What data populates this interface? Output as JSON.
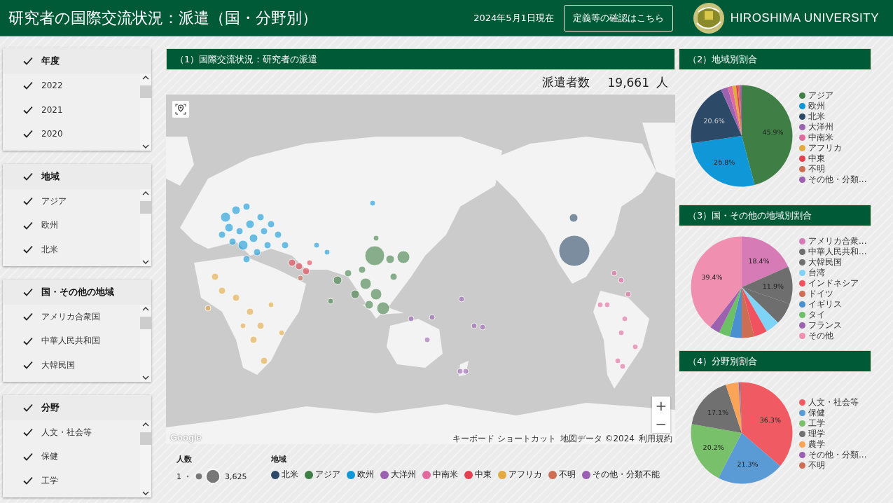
{
  "header": {
    "title": "研究者の国際交流状況：派遣（国・分野別）",
    "date": "2024年5月1日現在",
    "link_button": "定義等の確認はこちら",
    "logo_text": "HIROSHIMA UNIVERSITY"
  },
  "filters": [
    {
      "title": "年度",
      "checked": true,
      "items": [
        {
          "label": "2022",
          "checked": true
        },
        {
          "label": "2021",
          "checked": true
        },
        {
          "label": "2020",
          "checked": true
        }
      ]
    },
    {
      "title": "地域",
      "checked": true,
      "items": [
        {
          "label": "アジア",
          "checked": true
        },
        {
          "label": "欧州",
          "checked": true
        },
        {
          "label": "北米",
          "checked": true
        }
      ]
    },
    {
      "title": "国・その他の地域",
      "checked": true,
      "items": [
        {
          "label": "アメリカ合衆国",
          "checked": true
        },
        {
          "label": "中華人民共和国",
          "checked": true
        },
        {
          "label": "大韓民国",
          "checked": true
        }
      ]
    },
    {
      "title": "分野",
      "checked": true,
      "items": [
        {
          "label": "人文・社会等",
          "checked": true
        },
        {
          "label": "保健",
          "checked": true
        },
        {
          "label": "工学",
          "checked": true
        }
      ]
    }
  ],
  "map_panel": {
    "title": "（1）国際交流状況：研究者の派遣",
    "count_label": "派遣者数",
    "count": "19,661",
    "count_unit": "人",
    "zoom_in": "+",
    "zoom_out": "−",
    "google": "Google",
    "attribution": [
      "キーボード ショートカット",
      "地図データ ©2024",
      "利用規約"
    ],
    "size_legend": {
      "title": "人数",
      "min": "1",
      "max": "3,625"
    },
    "region_legend": {
      "title": "地域",
      "items": [
        {
          "label": "北米",
          "color": "#2c4a67"
        },
        {
          "label": "アジア",
          "color": "#3f7f45"
        },
        {
          "label": "欧州",
          "color": "#0f97d8"
        },
        {
          "label": "大洋州",
          "color": "#9b62b0"
        },
        {
          "label": "中南米",
          "color": "#e0699e"
        },
        {
          "label": "中東",
          "color": "#e5404f"
        },
        {
          "label": "アフリカ",
          "color": "#e2a93f"
        },
        {
          "label": "不明",
          "color": "#cd6d53"
        },
        {
          "label": "その他・分類不能",
          "color": "#9b5fb4"
        }
      ]
    }
  },
  "pies": [
    {
      "title": "（2）地域別割合",
      "chart_data": {
        "type": "pie",
        "categories": [
          "アジア",
          "欧州",
          "北米",
          "大洋州",
          "中南米",
          "アフリカ",
          "中東",
          "不明",
          "その他・分類..."
        ],
        "values": [
          45.9,
          26.8,
          20.6,
          2.2,
          1.5,
          1.2,
          0.6,
          0.6,
          0.6
        ],
        "colors": [
          "#3f7f45",
          "#0f97d8",
          "#2c4a67",
          "#9b62b0",
          "#e0699e",
          "#e2a93f",
          "#e5404f",
          "#cd6d53",
          "#9b5fb4"
        ],
        "value_labels": [
          "45.9%",
          "26.8%",
          "20.6%",
          null,
          null,
          null,
          null,
          null,
          null
        ]
      }
    },
    {
      "title": "（3）国・その他の地域別割合",
      "chart_data": {
        "type": "pie",
        "categories": [
          "アメリカ合衆...",
          "中華人民共和...",
          "大韓民国",
          "台湾",
          "インドネシア",
          "ドイツ",
          "イギリス",
          "タイ",
          "フランス",
          "その他"
        ],
        "values": [
          18.4,
          11.9,
          7.0,
          4.5,
          4.2,
          4.0,
          3.8,
          3.6,
          3.2,
          39.4
        ],
        "colors": [
          "#d67bb5",
          "#6e6e6e",
          "#6e6e6e",
          "#7fd3f7",
          "#f0525f",
          "#cd6d53",
          "#4a90d0",
          "#6cc065",
          "#9b62b0",
          "#f18fb0"
        ],
        "value_labels": [
          "18.4%",
          "11.9%",
          null,
          null,
          null,
          null,
          null,
          null,
          null,
          "39.4%"
        ]
      }
    },
    {
      "title": "（4）分野別割合",
      "chart_data": {
        "type": "pie",
        "categories": [
          "人文・社会等",
          "保健",
          "工学",
          "理学",
          "農学",
          "その他・分類...",
          "不明"
        ],
        "values": [
          36.3,
          21.3,
          20.2,
          17.1,
          4.1,
          0.5,
          0.5
        ],
        "colors": [
          "#f05a62",
          "#5b9bd5",
          "#79c06a",
          "#707070",
          "#f9a457",
          "#9b5fb4",
          "#cd6d53"
        ],
        "value_labels": [
          "36.3%",
          "21.3%",
          "20.2%",
          "17.1%",
          null,
          null,
          null
        ]
      }
    }
  ]
}
